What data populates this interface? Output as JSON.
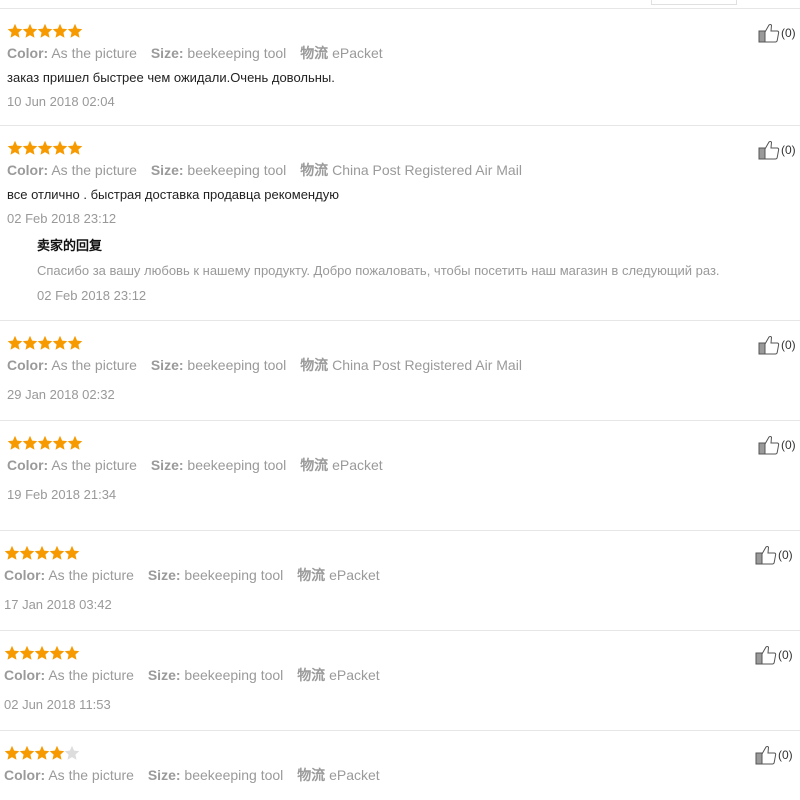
{
  "colors": {
    "star_on": "#f79a00",
    "star_off": "#dddddd"
  },
  "reviews": [
    {
      "rating": 5,
      "color_key": "Color:",
      "color_val": "As the picture",
      "size_key": "Size:",
      "size_val": "beekeeping tool",
      "ship_key": "物流",
      "ship_val": "ePacket",
      "text": "заказ пришел быстрее чем ожидали.Очень довольны.",
      "date": "10 Jun 2018 02:04",
      "likes": "(0)"
    },
    {
      "rating": 5,
      "color_key": "Color:",
      "color_val": "As the picture",
      "size_key": "Size:",
      "size_val": "beekeeping tool",
      "ship_key": "物流",
      "ship_val": "China Post Registered Air Mail",
      "text": "все отлично . быстрая доставка продавца рекомендую",
      "date": "02 Feb 2018 23:12",
      "likes": "(0)",
      "reply": {
        "title": "卖家的回复",
        "text": "Спасибо за вашу любовь к нашему продукту. Добро пожаловать, чтобы посетить наш магазин в следующий раз.",
        "date": "02 Feb 2018 23:12"
      }
    },
    {
      "rating": 5,
      "color_key": "Color:",
      "color_val": "As the picture",
      "size_key": "Size:",
      "size_val": "beekeeping tool",
      "ship_key": "物流",
      "ship_val": "China Post Registered Air Mail",
      "date": "29 Jan 2018 02:32",
      "likes": "(0)"
    },
    {
      "rating": 5,
      "color_key": "Color:",
      "color_val": "As the picture",
      "size_key": "Size:",
      "size_val": "beekeeping tool",
      "ship_key": "物流",
      "ship_val": "ePacket",
      "date": "19 Feb 2018 21:34",
      "likes": "(0)"
    },
    {
      "rating": 5,
      "color_key": "Color:",
      "color_val": "As the picture",
      "size_key": "Size:",
      "size_val": "beekeeping tool",
      "ship_key": "物流",
      "ship_val": "ePacket",
      "date": "17 Jan 2018 03:42",
      "likes": "(0)"
    },
    {
      "rating": 5,
      "color_key": "Color:",
      "color_val": "As the picture",
      "size_key": "Size:",
      "size_val": "beekeeping tool",
      "ship_key": "物流",
      "ship_val": "ePacket",
      "date": "02 Jun 2018 11:53",
      "likes": "(0)"
    },
    {
      "rating": 4,
      "color_key": "Color:",
      "color_val": "As the picture",
      "size_key": "Size:",
      "size_val": "beekeeping tool",
      "ship_key": "物流",
      "ship_val": "ePacket",
      "likes": "(0)"
    }
  ]
}
